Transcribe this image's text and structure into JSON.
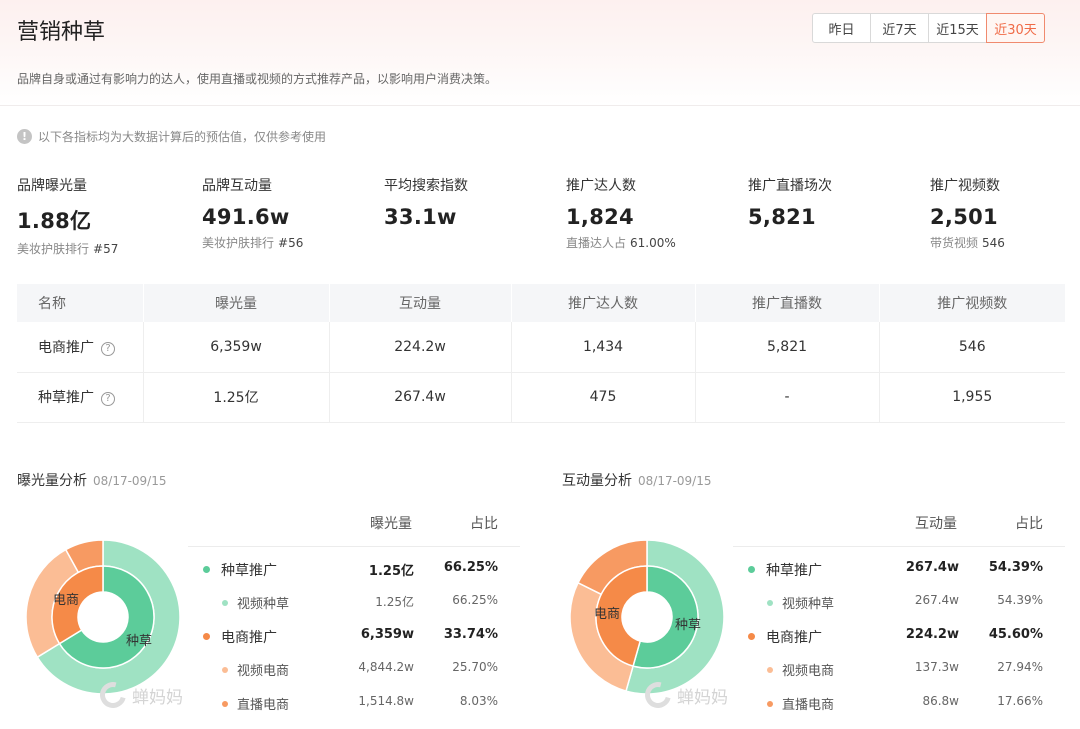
{
  "header": {
    "title": "营销种草",
    "description": "品牌自身或通过有影响力的达人，使用直播或视频的方式推荐产品，以影响用户消费决策。",
    "date_tabs": [
      "昨日",
      "近7天",
      "近15天",
      "近30天"
    ],
    "active_tab": "近30天"
  },
  "notice": "以下各指标均为大数据计算后的预估值，仅供参考使用",
  "metrics": [
    {
      "label": "品牌曝光量",
      "value": "1.88亿",
      "sub": "美妆护肤排行",
      "rank": "#57"
    },
    {
      "label": "品牌互动量",
      "value": "491.6w",
      "sub": "美妆护肤排行",
      "rank": "#56"
    },
    {
      "label": "平均搜索指数",
      "value": "33.1w"
    },
    {
      "label": "推广达人数",
      "value": "1,824",
      "sub": "直播达人占",
      "rank": "61.00%"
    },
    {
      "label": "推广直播场次",
      "value": "5,821"
    },
    {
      "label": "推广视频数",
      "value": "2,501",
      "sub": "带货视频",
      "rank": "546"
    }
  ],
  "table": {
    "headers": [
      "名称",
      "曝光量",
      "互动量",
      "推广达人数",
      "推广直播数",
      "推广视频数"
    ],
    "rows": [
      [
        "电商推广",
        "6,359w",
        "224.2w",
        "1,434",
        "5,821",
        "546"
      ],
      [
        "种草推广",
        "1.25亿",
        "267.4w",
        "475",
        "-",
        "1,955"
      ]
    ]
  },
  "exposure": {
    "title": "曝光量分析",
    "date": "08/17-09/15",
    "col_value": "曝光量",
    "col_pct": "占比",
    "inner_labels": [
      "电商",
      "种草"
    ],
    "rows": [
      {
        "name": "种草推广",
        "value": "1.25亿",
        "pct": "66.25%",
        "level": "parent",
        "color": "#5ccc9a"
      },
      {
        "name": "视频种草",
        "value": "1.25亿",
        "pct": "66.25%",
        "level": "child",
        "color": "#9fe2c3"
      },
      {
        "name": "电商推广",
        "value": "6,359w",
        "pct": "33.74%",
        "level": "parent",
        "color": "#f58a48"
      },
      {
        "name": "视频电商",
        "value": "4,844.2w",
        "pct": "25.70%",
        "level": "child",
        "color": "#fbbd95"
      },
      {
        "name": "直播电商",
        "value": "1,514.8w",
        "pct": "8.03%",
        "level": "child",
        "color": "#f79a62"
      }
    ]
  },
  "interaction": {
    "title": "互动量分析",
    "date": "08/17-09/15",
    "col_value": "互动量",
    "col_pct": "占比",
    "inner_labels": [
      "电商",
      "种草"
    ],
    "rows": [
      {
        "name": "种草推广",
        "value": "267.4w",
        "pct": "54.39%",
        "level": "parent",
        "color": "#5ccc9a"
      },
      {
        "name": "视频种草",
        "value": "267.4w",
        "pct": "54.39%",
        "level": "child",
        "color": "#9fe2c3"
      },
      {
        "name": "电商推广",
        "value": "224.2w",
        "pct": "45.60%",
        "level": "parent",
        "color": "#f58a48"
      },
      {
        "name": "视频电商",
        "value": "137.3w",
        "pct": "27.94%",
        "level": "child",
        "color": "#fbbd95"
      },
      {
        "name": "直播电商",
        "value": "86.8w",
        "pct": "17.66%",
        "level": "child",
        "color": "#f79a62"
      }
    ]
  },
  "chart_data": [
    {
      "type": "pie",
      "title": "曝光量分析",
      "inner": {
        "categories": [
          "种草推广",
          "电商推广"
        ],
        "values": [
          66.25,
          33.74
        ]
      },
      "outer": {
        "categories": [
          "视频种草",
          "视频电商",
          "直播电商"
        ],
        "values": [
          66.25,
          25.7,
          8.03
        ]
      }
    },
    {
      "type": "pie",
      "title": "互动量分析",
      "inner": {
        "categories": [
          "种草推广",
          "电商推广"
        ],
        "values": [
          54.39,
          45.6
        ]
      },
      "outer": {
        "categories": [
          "视频种草",
          "视频电商",
          "直播电商"
        ],
        "values": [
          54.39,
          27.94,
          17.66
        ]
      }
    }
  ],
  "colors": {
    "zc_inner": "#5ccc9a",
    "zc_outer": "#9fe2c3",
    "ds_inner": "#f58a48",
    "ds_video": "#fbbd95",
    "ds_live": "#f79a62",
    "accent": "#f06b47"
  },
  "watermark": "蝉妈妈"
}
